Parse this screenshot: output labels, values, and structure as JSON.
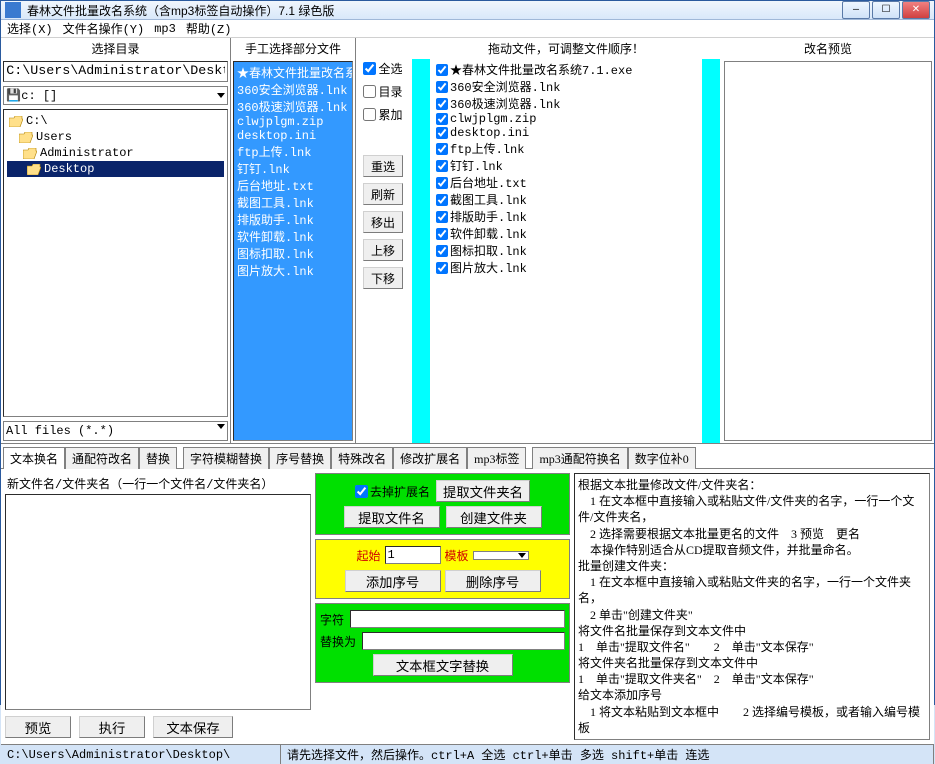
{
  "window": {
    "title": "春林文件批量改名系统（含mp3标签自动操作）7.1  绿色版"
  },
  "menu": {
    "select": "选择(X)",
    "filename": "文件名操作(Y)",
    "mp3": "mp3",
    "help": "帮助(Z)"
  },
  "dir_panel": {
    "header": "选择目录",
    "path": "C:\\Users\\Administrator\\Deskt",
    "drive_icon": "💾",
    "drive": "c: []",
    "tree": {
      "root": "C:\\",
      "node1": "Users",
      "node2": "Administrator",
      "node3": "Desktop"
    },
    "filter": "All files (*.*)"
  },
  "files_panel": {
    "header": "手工选择部分文件",
    "items": [
      "★春林文件批量改名系",
      "360安全浏览器.lnk",
      "360极速浏览器.lnk",
      "clwjplgm.zip",
      "desktop.ini",
      "ftp上传.lnk",
      "钉钉.lnk",
      "后台地址.txt",
      "截图工具.lnk",
      "排版助手.lnk",
      "软件卸载.lnk",
      "图标扣取.lnk",
      "图片放大.lnk"
    ]
  },
  "opts": {
    "select_all": "全选",
    "dir": "目录",
    "accumulate": "累加",
    "reselect": "重选",
    "refresh": "刷新",
    "move_out": "移出",
    "move_up": "上移",
    "move_down": "下移"
  },
  "drag_panel": {
    "header": "拖动文件，可调整文件顺序！",
    "items": [
      "★春林文件批量改名系统7.1.exe",
      "360安全浏览器.lnk",
      "360极速浏览器.lnk",
      "clwjplgm.zip",
      "desktop.ini",
      "ftp上传.lnk",
      "钉钉.lnk",
      "后台地址.txt",
      "截图工具.lnk",
      "排版助手.lnk",
      "软件卸载.lnk",
      "图标扣取.lnk",
      "图片放大.lnk"
    ]
  },
  "preview_panel": {
    "header": "改名预览"
  },
  "tabs": {
    "t0": "文本换名",
    "t1": "通配符改名",
    "t2": "替换",
    "t3": "字符模糊替换",
    "t4": "序号替换",
    "t5": "特殊改名",
    "t6": "修改扩展名",
    "t7": "mp3标签",
    "t8": "mp3通配符换名",
    "t9": "数字位补0"
  },
  "lower_left": {
    "label": "新文件名/文件夹名（一行一个文件名/文件夹名）",
    "preview": "预览",
    "execute": "执行",
    "save": "文本保存"
  },
  "green1": {
    "strip_ext": "去掉扩展名",
    "extract_folder": "提取文件夹名",
    "extract_file": "提取文件名",
    "create_folder": "创建文件夹"
  },
  "yellow": {
    "start_label": "起始",
    "start_value": "1",
    "template_label": "模板",
    "add_seq": "添加序号",
    "del_seq": "删除序号"
  },
  "green2": {
    "char_label": "字符",
    "replace_label": "替换为",
    "replace_btn": "文本框文字替换"
  },
  "help_text": {
    "l1": "根据文本批量修改文件/文件夹名：",
    "l2": "　1 在文本框中直接输入或粘贴文件/文件夹的名字，一行一个文件/文件夹名，",
    "l3": "　2 选择需要根据文本批量更名的文件　3 预览　更名",
    "l4": "　本操作特别适合从CD提取音频文件，并批量命名。",
    "l5": "批量创建文件夹：",
    "l6": "　1 在文本框中直接输入或粘贴文件夹的名字，一行一个文件夹名，",
    "l7": "　2 单击\"创建文件夹\"",
    "l8": "将文件名批量保存到文本文件中",
    "l9": "1　单击\"提取文件名\"　　2　单击\"文本保存\"",
    "l10": "将文件夹名批量保存到文本文件中",
    "l11": "1　单击\"提取文件夹名\"　2　单击\"文本保存\"",
    "l12": "给文本添加序号",
    "l13": "　1 将文本粘贴到文本框中　　2 选择编号模板，或者输入编号模板"
  },
  "status": {
    "path": "C:\\Users\\Administrator\\Desktop\\",
    "hint": "请先选择文件，然后操作。ctrl+A 全选 ctrl+单击 多选 shift+单击 连选"
  }
}
